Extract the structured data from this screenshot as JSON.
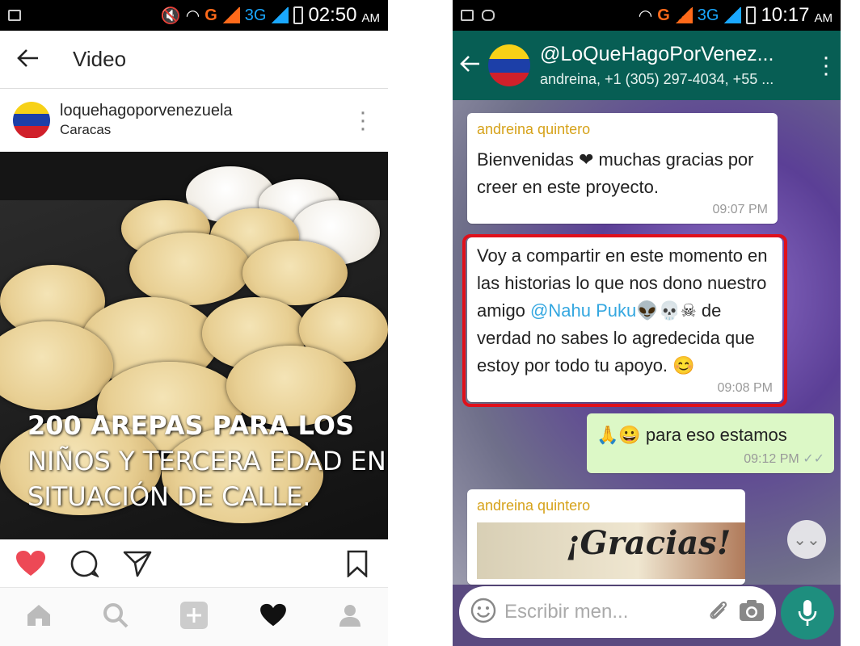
{
  "left": {
    "status": {
      "time": "02:50",
      "ampm": "AM",
      "network_g": "G",
      "network_3g": "3G"
    },
    "header": {
      "title": "Video"
    },
    "post": {
      "username": "loquehagoporvenezuela",
      "location": "Caracas",
      "video_caption": [
        "200 AREPAS PARA LOS",
        "NIÑOS Y TERCERA EDAD EN",
        "SITUACIÓN DE CALLE."
      ]
    },
    "actions": [
      "heart-icon",
      "comment-icon",
      "share-icon",
      "bookmark-icon"
    ],
    "nav": [
      "home-icon",
      "search-icon",
      "add-icon",
      "activity-icon",
      "profile-icon"
    ],
    "colors": {
      "like": "#ed4956",
      "text": "#262626"
    }
  },
  "right": {
    "status": {
      "time": "10:17",
      "ampm": "AM",
      "network_g": "G",
      "network_3g": "3G"
    },
    "header": {
      "title": "@LoQueHagoPorVenez...",
      "subtitle": "andreina, +1 (305) 297-4034, +55 ..."
    },
    "messages": [
      {
        "sender": "andreina quintero",
        "text": "Bienvenidas ❤ muchas gracias por creer en este proyecto.",
        "time": "09:07 PM"
      },
      {
        "text_before": "Voy a compartir en este momento en las historias lo que nos dono nuestro amigo ",
        "mention": "@Nahu Puku",
        "text_after": "👽💀☠ de verdad no sabes lo agredecida que estoy por todo tu apoyo. 😊",
        "time": "09:08 PM"
      },
      {
        "text": "🙏😀 para eso estamos",
        "time": "09:12 PM",
        "outgoing": true
      },
      {
        "sender": "andreina quintero",
        "image_text": "¡Gracias!"
      }
    ],
    "input": {
      "placeholder": "Escribir men..."
    },
    "colors": {
      "header": "#075e54",
      "outgoing": "#dcf8c6",
      "sender": "#d6a21a",
      "highlight": "#e0101b",
      "mention": "#34a7e0"
    }
  }
}
